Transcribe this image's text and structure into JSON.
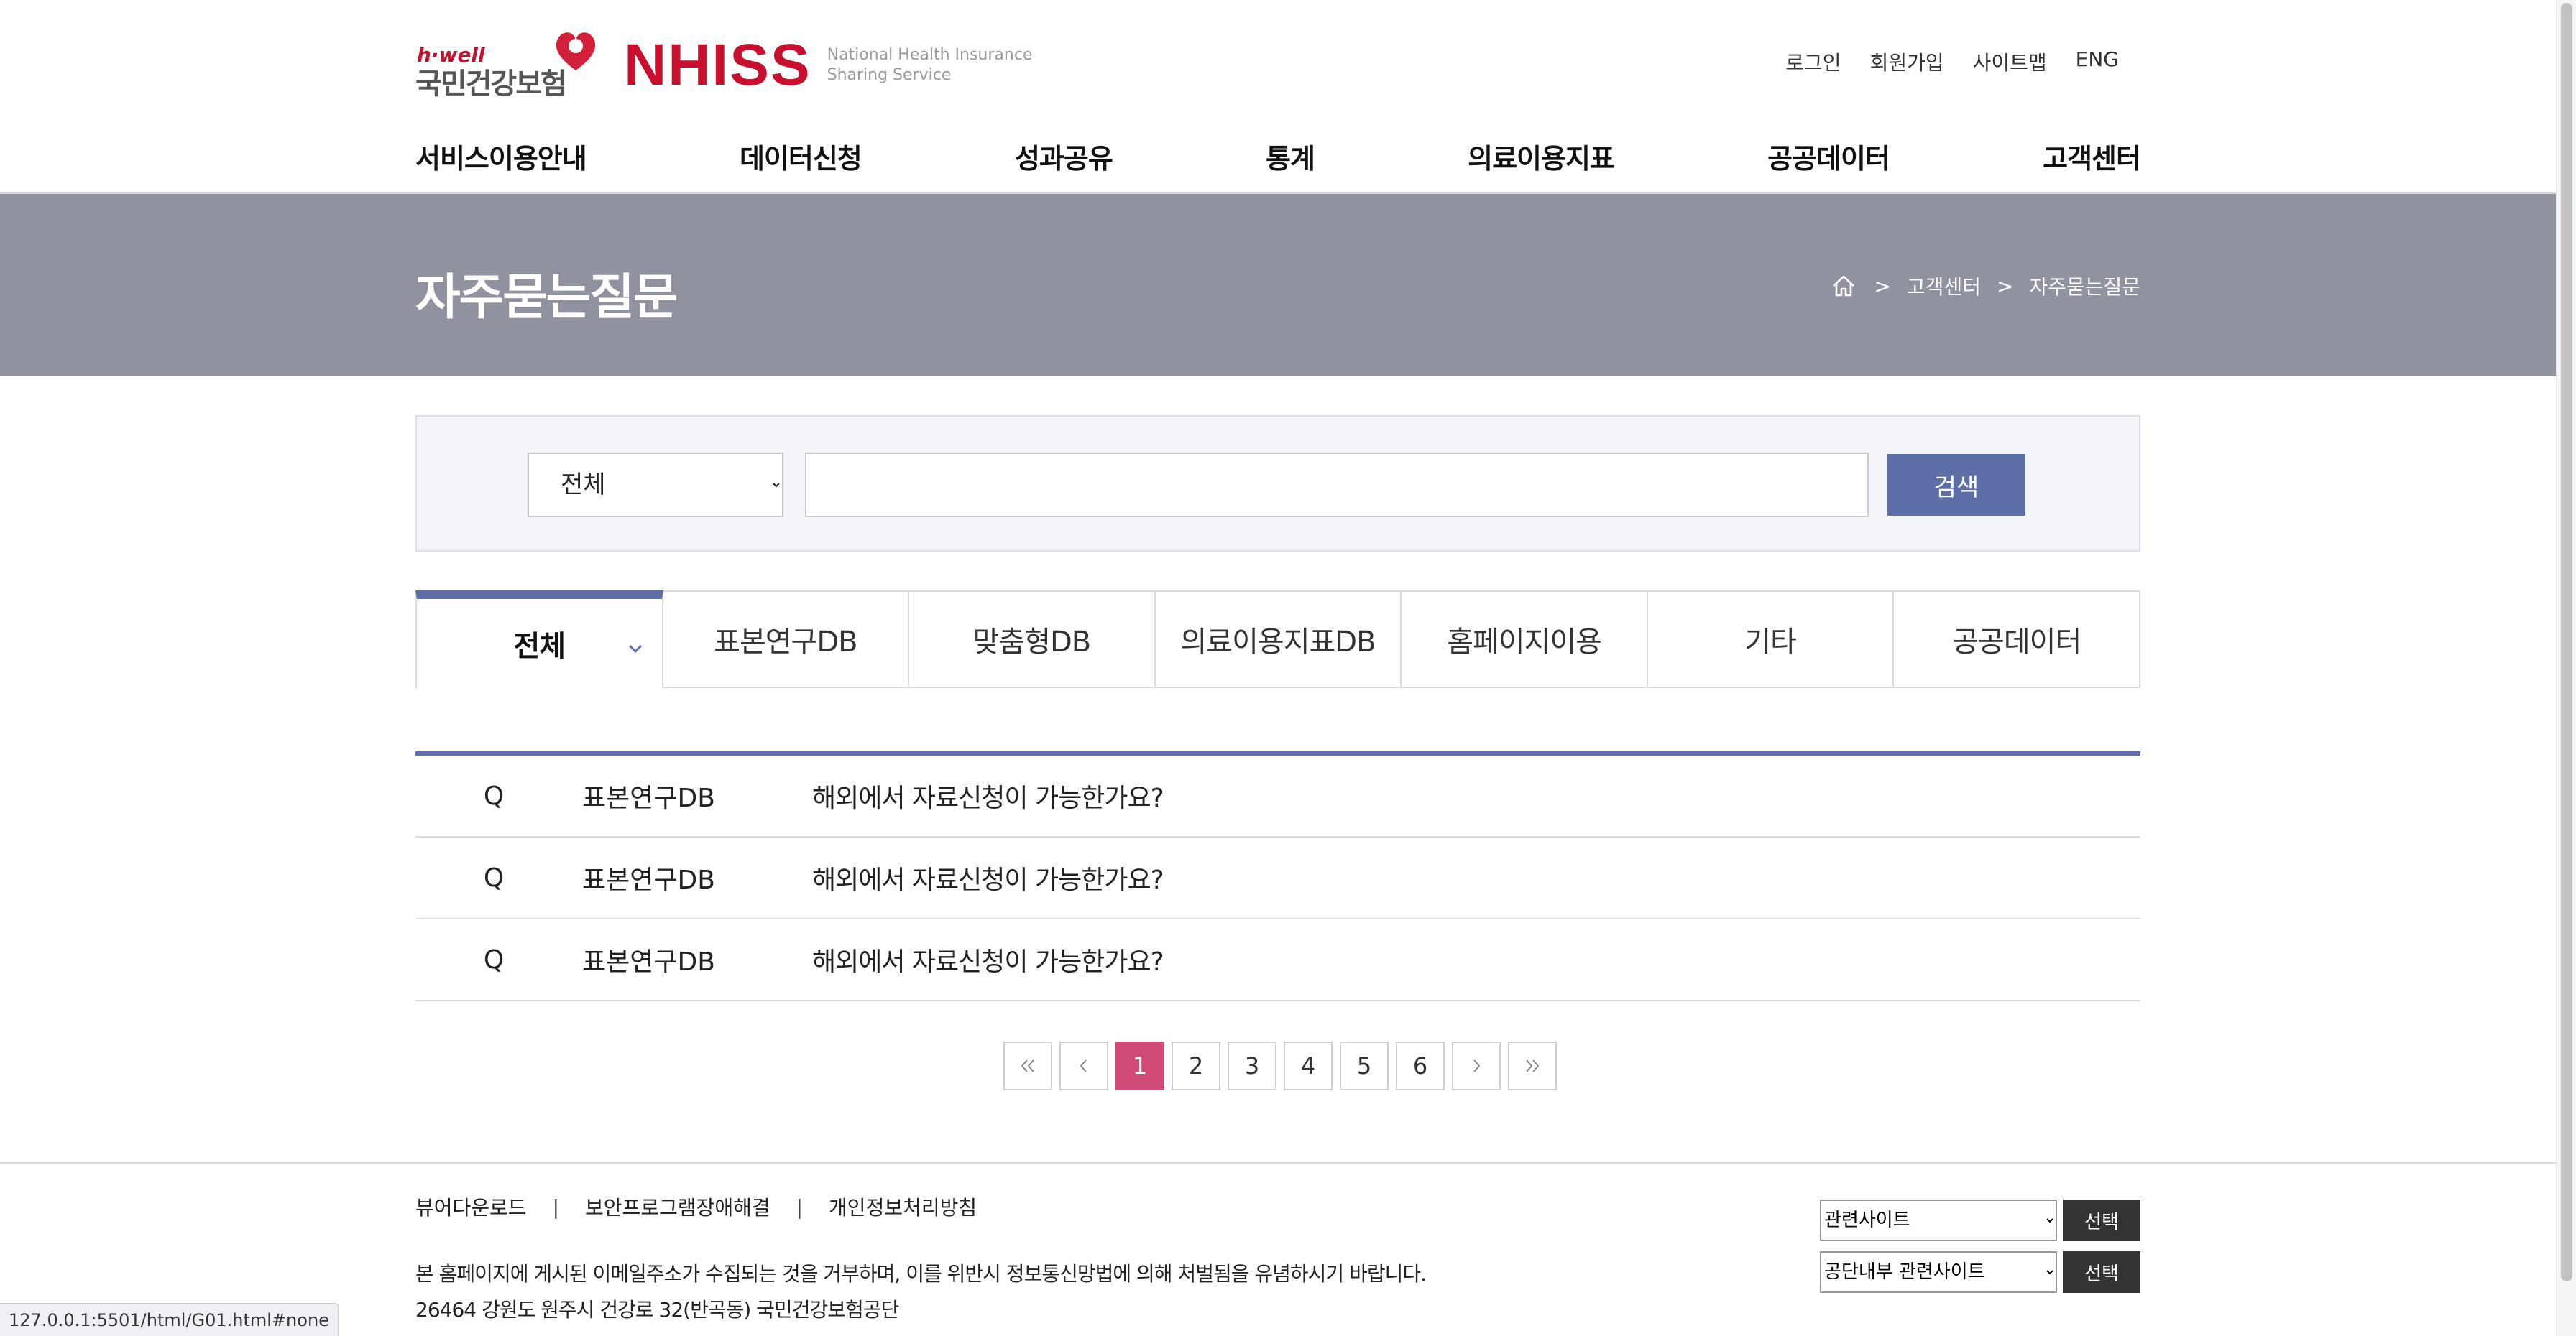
{
  "brand": {
    "hwell": "h·well",
    "korean_name": "국민건강보험",
    "nhiss": "NHISS",
    "sub_line1": "National Health Insurance",
    "sub_line2": "Sharing Service"
  },
  "util_menu": [
    "로그인",
    "회원가입",
    "사이트맵",
    "ENG"
  ],
  "gnb": [
    "서비스이용안내",
    "데이터신청",
    "성과공유",
    "통계",
    "의료이용지표",
    "공공데이터",
    "고객센터"
  ],
  "page_title": "자주묻는질문",
  "breadcrumb": {
    "sep": ">",
    "level1": "고객센터",
    "level2": "자주묻는질문"
  },
  "search": {
    "select_value": "전체",
    "input_value": "",
    "button_label": "검색"
  },
  "tabs": [
    "전체",
    "표본연구DB",
    "맞춤형DB",
    "의료이용지표DB",
    "홈페이지이용",
    "기타",
    "공공데이터"
  ],
  "faq_rows": [
    {
      "q": "Q",
      "category": "표본연구DB",
      "question": "해외에서 자료신청이 가능한가요?"
    },
    {
      "q": "Q",
      "category": "표본연구DB",
      "question": "해외에서 자료신청이 가능한가요?"
    },
    {
      "q": "Q",
      "category": "표본연구DB",
      "question": "해외에서 자료신청이 가능한가요?"
    }
  ],
  "pagination": {
    "pages": [
      "1",
      "2",
      "3",
      "4",
      "5",
      "6"
    ],
    "current": "1"
  },
  "footer": {
    "links": [
      "뷰어다운로드",
      "보안프로그램장애해결",
      "개인정보처리방침"
    ],
    "link_sep": "|",
    "notice": "본 홈페이지에 게시된 이메일주소가 수집되는 것을 거부하며, 이를 위반시 정보통신망법에 의해 처벌됨을 유념하시기 바랍니다.",
    "address": "26464 강원도 원주시 건강로 32(반곡동) 국민건강보험공단",
    "related_select": "관련사이트",
    "internal_select": "공단내부 관련사이트",
    "select_button": "선택"
  },
  "status_url": "127.0.0.1:5501/html/G01.html#none",
  "colors": {
    "accent": "#5e6fa7",
    "band": "#90939f",
    "page_active": "#d04a78",
    "brand_red": "#c8102e"
  }
}
